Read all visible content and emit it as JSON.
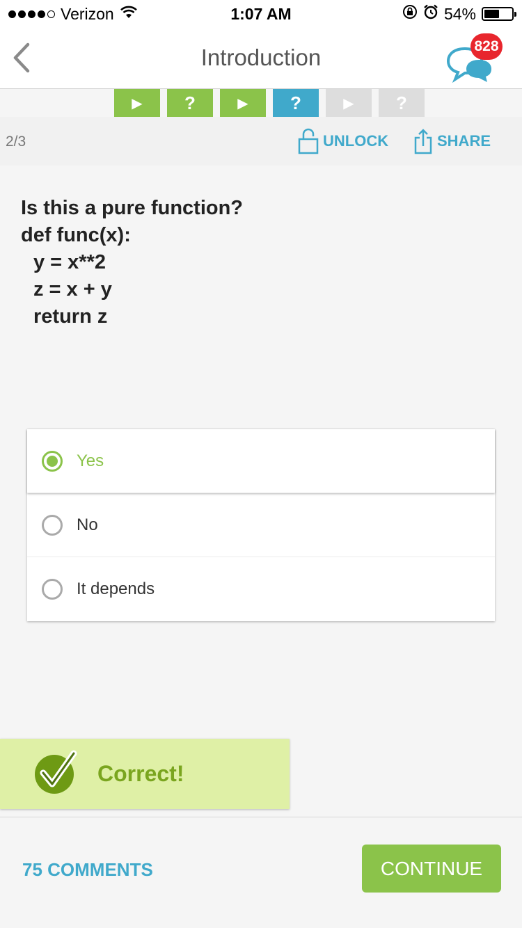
{
  "status_bar": {
    "carrier": "Verizon",
    "time": "1:07 AM",
    "battery": "54%",
    "battery_level": 0.54
  },
  "nav": {
    "title": "Introduction",
    "badge_count": "828",
    "back_icon": "chevron-left-icon",
    "chat_icon": "chat-bubbles-icon"
  },
  "steps": [
    {
      "type": "video",
      "glyph": "▶",
      "state": "done"
    },
    {
      "type": "quiz",
      "glyph": "?",
      "state": "done"
    },
    {
      "type": "video",
      "glyph": "▶",
      "state": "done"
    },
    {
      "type": "quiz",
      "glyph": "?",
      "state": "active"
    },
    {
      "type": "video",
      "glyph": "▶",
      "state": "locked"
    },
    {
      "type": "quiz",
      "glyph": "?",
      "state": "locked"
    }
  ],
  "lesson": {
    "count": "2/3",
    "unlock_label": "UNLOCK",
    "share_label": "SHARE"
  },
  "question": {
    "line1": "Is this a pure function?",
    "line2": "def func(x):",
    "line3": "y = x**2",
    "line4": "z = x + y",
    "line5": "return z"
  },
  "options": [
    {
      "label": "Yes",
      "selected": true
    },
    {
      "label": "No",
      "selected": false
    },
    {
      "label": "It depends",
      "selected": false
    }
  ],
  "feedback": {
    "text": "Correct!"
  },
  "footer": {
    "comments_label": "75 COMMENTS",
    "continue_label": "CONTINUE"
  },
  "colors": {
    "green": "#8bc34a",
    "blue": "#40a9cb",
    "badge_red": "#e8262d",
    "feedback_bg": "#dff0a6"
  }
}
